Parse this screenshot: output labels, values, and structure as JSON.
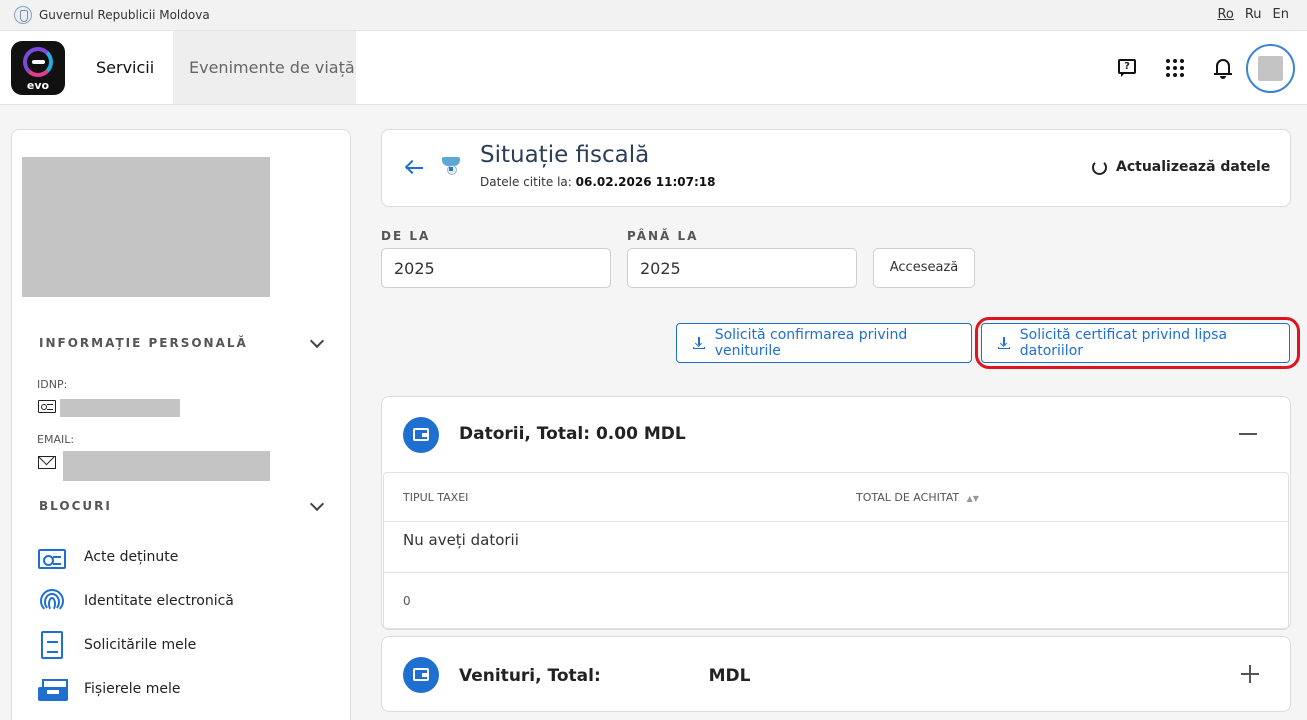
{
  "topbar": {
    "gov_name": "Guvernul Republicii Moldova",
    "langs": [
      "Ro",
      "Ru",
      "En"
    ]
  },
  "header": {
    "logo_text": "evo",
    "nav": {
      "servicii": "Servicii",
      "evenimente": "Evenimente de viață"
    },
    "chat_icon_glyph": "?"
  },
  "sidebar": {
    "personal_title": "INFORMAȚIE PERSONALĂ",
    "idnp_label": "IDNP:",
    "email_label": "EMAIL:",
    "blocks_title": "BLOCURI",
    "items": [
      {
        "label": "Acte deținute",
        "icon": "id-card-icon"
      },
      {
        "label": "Identitate electronică",
        "icon": "fingerprint-icon"
      },
      {
        "label": "Solicitările mele",
        "icon": "document-icon"
      },
      {
        "label": "Fișierele mele",
        "icon": "inbox-tray-icon"
      }
    ]
  },
  "main": {
    "title": "Situație fiscală",
    "read_prefix": "Datele citite la:",
    "read_value": "06.02.2026 11:07:18",
    "refresh_label": "Actualizează datele",
    "from_label": "DE LA",
    "from_value": "2025",
    "to_label": "PÂNĂ LA",
    "to_value": "2025",
    "access_button": "Accesează",
    "btn_income": "Solicită confirmarea privind veniturile",
    "btn_certificate": "Solicită certificat privind lipsa datoriilor",
    "debts": {
      "title": "Datorii, Total: 0.00 MDL",
      "col_tax": "TIPUL TAXEI",
      "col_total": "TOTAL DE ACHITAT",
      "empty": "Nu aveți datorii",
      "footer": "0"
    },
    "income": {
      "title_prefix": "Venituri, Total:",
      "title_suffix": "MDL"
    }
  },
  "colors": {
    "accent": "#1f6fd1",
    "highlight": "#e0141e",
    "title": "#2d3e57"
  }
}
